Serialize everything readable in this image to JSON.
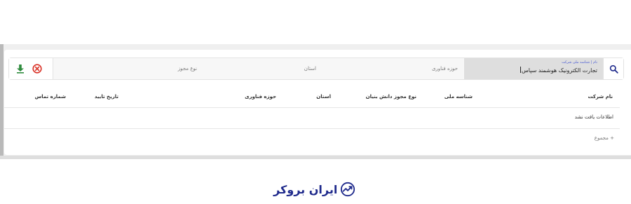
{
  "filters": {
    "company_small_label": "نام | شناسه ملی شرکت",
    "company_value": "تجارت الکترونیک هوشمند سپاس",
    "tech_field_placeholder": "حوزه فناوری",
    "province_placeholder": "استان",
    "license_type_placeholder": "نوع مجوز",
    "icons": {
      "search": "search-icon",
      "download": "download-icon",
      "clear": "clear-filter-icon"
    },
    "colors": {
      "accent": "#1f2a8c",
      "download": "#2e8b3d",
      "clear": "#d93025"
    }
  },
  "table": {
    "headers": {
      "company_name": "نام شرکت",
      "national_id": "شناسه ملی",
      "license_type": "نوع مجوز دانش بنیان",
      "province": "استان",
      "tech_field": "حوزه فناوری",
      "approval_date": "تاریخ تایید",
      "phone": "شماره تماس"
    },
    "empty_message": "اطلاعات یافت نشد",
    "total_label": "+ مجموع"
  },
  "brand": {
    "logo_text": "ایران بروکر",
    "logo_icon": "trend-chart-icon"
  }
}
